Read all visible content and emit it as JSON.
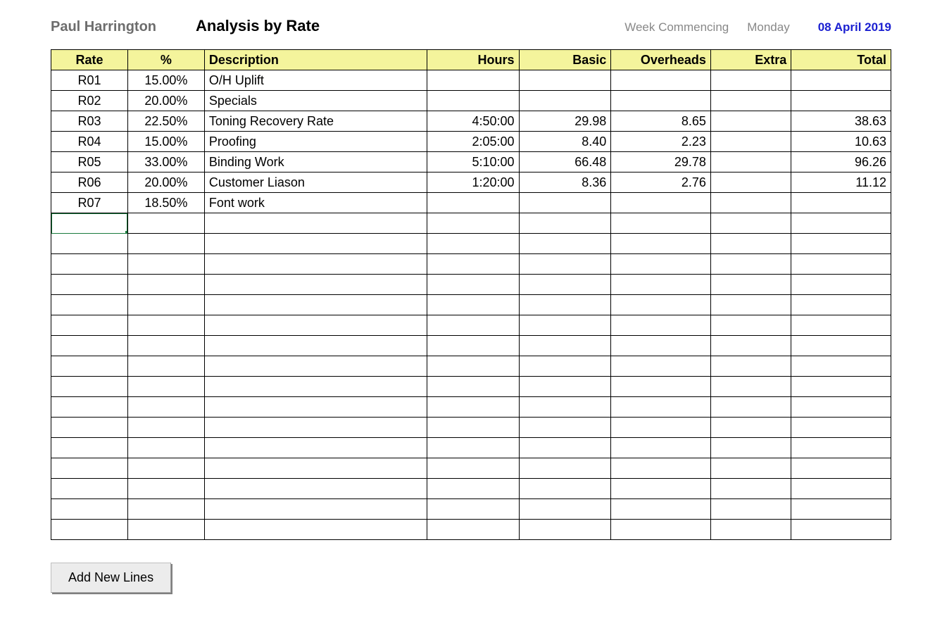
{
  "header": {
    "user_name": "Paul Harrington",
    "title": "Analysis by Rate",
    "week_label": "Week Commencing",
    "week_day": "Monday",
    "week_date": "08 April 2019"
  },
  "table": {
    "columns": {
      "rate": "Rate",
      "pct": "%",
      "desc": "Description",
      "hours": "Hours",
      "basic": "Basic",
      "overheads": "Overheads",
      "extra": "Extra",
      "total": "Total"
    },
    "rows": [
      {
        "rate": "R01",
        "pct": "15.00%",
        "desc": "O/H Uplift",
        "hours": "",
        "basic": "",
        "overheads": "",
        "extra": "",
        "total": ""
      },
      {
        "rate": "R02",
        "pct": "20.00%",
        "desc": "Specials",
        "hours": "",
        "basic": "",
        "overheads": "",
        "extra": "",
        "total": ""
      },
      {
        "rate": "R03",
        "pct": "22.50%",
        "desc": "Toning Recovery Rate",
        "hours": "4:50:00",
        "basic": "29.98",
        "overheads": "8.65",
        "extra": "",
        "total": "38.63"
      },
      {
        "rate": "R04",
        "pct": "15.00%",
        "desc": "Proofing",
        "hours": "2:05:00",
        "basic": "8.40",
        "overheads": "2.23",
        "extra": "",
        "total": "10.63"
      },
      {
        "rate": "R05",
        "pct": "33.00%",
        "desc": "Binding Work",
        "hours": "5:10:00",
        "basic": "66.48",
        "overheads": "29.78",
        "extra": "",
        "total": "96.26"
      },
      {
        "rate": "R06",
        "pct": "20.00%",
        "desc": "Customer Liason",
        "hours": "1:20:00",
        "basic": "8.36",
        "overheads": "2.76",
        "extra": "",
        "total": "11.12"
      },
      {
        "rate": "R07",
        "pct": "18.50%",
        "desc": "Font work",
        "hours": "",
        "basic": "",
        "overheads": "",
        "extra": "",
        "total": ""
      }
    ],
    "blank_row_count": 16,
    "selected_row_index": 7
  },
  "buttons": {
    "add_lines": "Add New Lines"
  }
}
